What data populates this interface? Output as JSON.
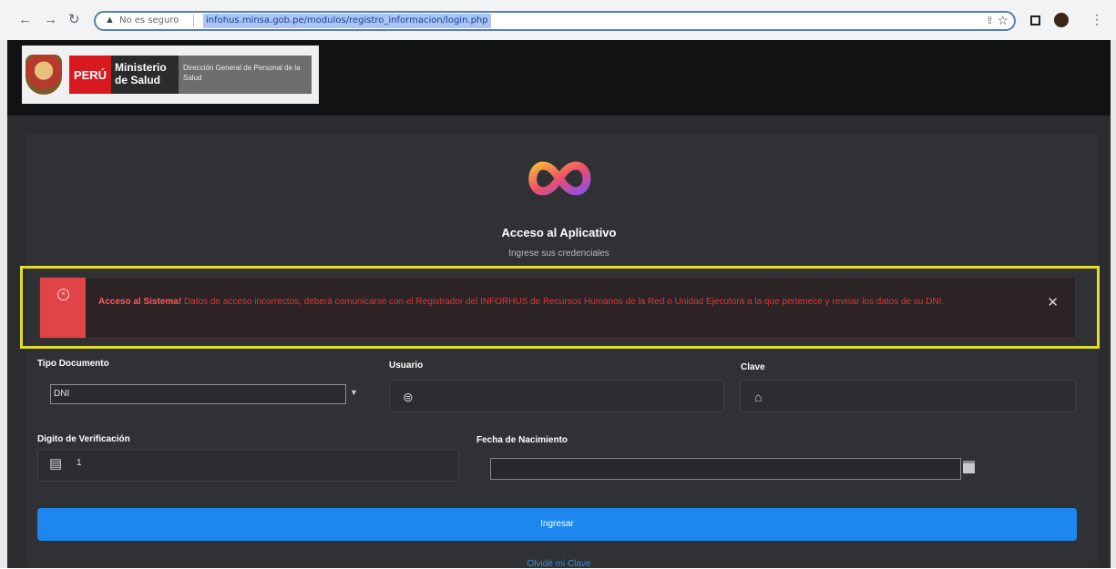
{
  "browser": {
    "security_label": "No es seguro",
    "url": "infohus.minsa.gob.pe/modulos/registro_informacion/login.php"
  },
  "header": {
    "logo_peru": "PERÚ",
    "logo_ministry": "Ministerio de Salud",
    "logo_directorate": "Dirección General de Personal de la Salud"
  },
  "login": {
    "title": "Acceso al Aplicativo",
    "subtitle": "Ingrese sus credenciales",
    "alert": {
      "strong": "Acceso al Sistema!",
      "message": "Datos de acceso incorrectos, deberá comunicarse con el Registrador del INFORHUS de Recursos Humanos de la Red o Unidad Ejecutora a la que pertenece y revisar los datos de su DNI."
    },
    "fields": {
      "tipo_documento_label": "Tipo Documento",
      "tipo_documento_value": "DNI",
      "usuario_label": "Usuario",
      "clave_label": "Clave",
      "digito_label": "Digito de Verificación",
      "digito_value": "1",
      "fecha_label": "Fecha de Nacimiento"
    },
    "submit_label": "Ingresar",
    "forgot_label": "Olvidé mi Clave"
  },
  "colors": {
    "alert_red": "#e04446",
    "button_blue": "#1c87ee",
    "highlight_yellow": "#e0dd2c",
    "card_bg": "#2f3134"
  },
  "icons": [
    "back-arrow-icon",
    "forward-arrow-icon",
    "reload-icon",
    "warning-icon",
    "share-icon",
    "star-icon",
    "app-logo-icon",
    "error-circle-icon",
    "close-icon",
    "user-icon",
    "lock-icon",
    "calendar-icon"
  ]
}
